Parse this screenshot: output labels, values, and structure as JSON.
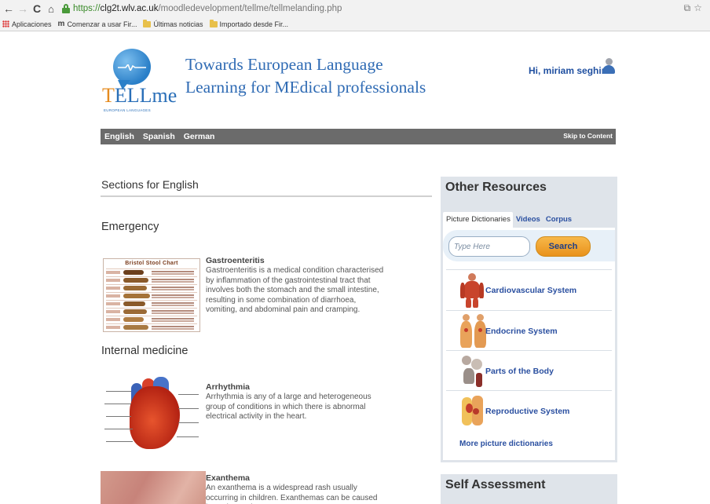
{
  "browser": {
    "url_scheme": "https://",
    "url_host": "clg2t.wlv.ac.uk",
    "url_path": "/moodledevelopment/tellme/tellmelanding.php",
    "bookmarks": [
      {
        "label": "Aplicaciones",
        "icon": "apps-grid-icon"
      },
      {
        "label": "Comenzar a usar Fir...",
        "icon": "m-icon"
      },
      {
        "label": "Últimas noticias",
        "icon": "folder-icon"
      },
      {
        "label": "Importado desde Fir...",
        "icon": "folder-icon"
      }
    ]
  },
  "logo": {
    "text_part1": "T",
    "text_part2": "ELLme",
    "subtitle": "EUROPEAN LANGUAGES"
  },
  "header": {
    "title_line1": "Towards European Language",
    "title_line2": "Learning for MEdical professionals",
    "greeting": "Hi, miriam seghiri"
  },
  "langbar": {
    "languages": [
      "English",
      "Spanish",
      "German"
    ],
    "skip_label": "Skip to Content"
  },
  "main": {
    "sections_title": "Sections for English",
    "categories": [
      {
        "name": "Emergency"
      },
      {
        "name": "Internal medicine"
      }
    ],
    "items": [
      {
        "title": "Gastroenteritis",
        "description": "Gastroenteritis is a medical condition characterised by inflammation of the gastrointestinal tract that involves both the stomach and the small intestine, resulting in some combination of diarrhoea, vomiting, and abdominal pain and cramping.",
        "thumb_title": "Bristol Stool Chart"
      },
      {
        "title": "Arrhythmia",
        "description": "Arrhythmia is any of a large and heterogeneous group of conditions in which there is abnormal electrical activity in the heart."
      },
      {
        "title": "Exanthema",
        "description": "An exanthema is a widespread rash usually occurring in children. Exanthemas can be caused by toxins or drugs,"
      }
    ]
  },
  "sidebar": {
    "title": "Other Resources",
    "tabs": [
      "Picture Dictionaries",
      "Videos",
      "Corpus"
    ],
    "search_placeholder": "Type Here",
    "search_button": "Search",
    "dictionaries": [
      {
        "label": "Cardiovascular System",
        "icon": "cardiovascular-figure-icon"
      },
      {
        "label": "Endocrine System",
        "icon": "endocrine-figure-icon"
      },
      {
        "label": "Parts of the Body",
        "icon": "body-parts-figure-icon"
      },
      {
        "label": "Reproductive System",
        "icon": "reproductive-figure-icon"
      }
    ],
    "more_link": "More picture dictionaries",
    "self_assessment_title": "Self Assessment"
  }
}
